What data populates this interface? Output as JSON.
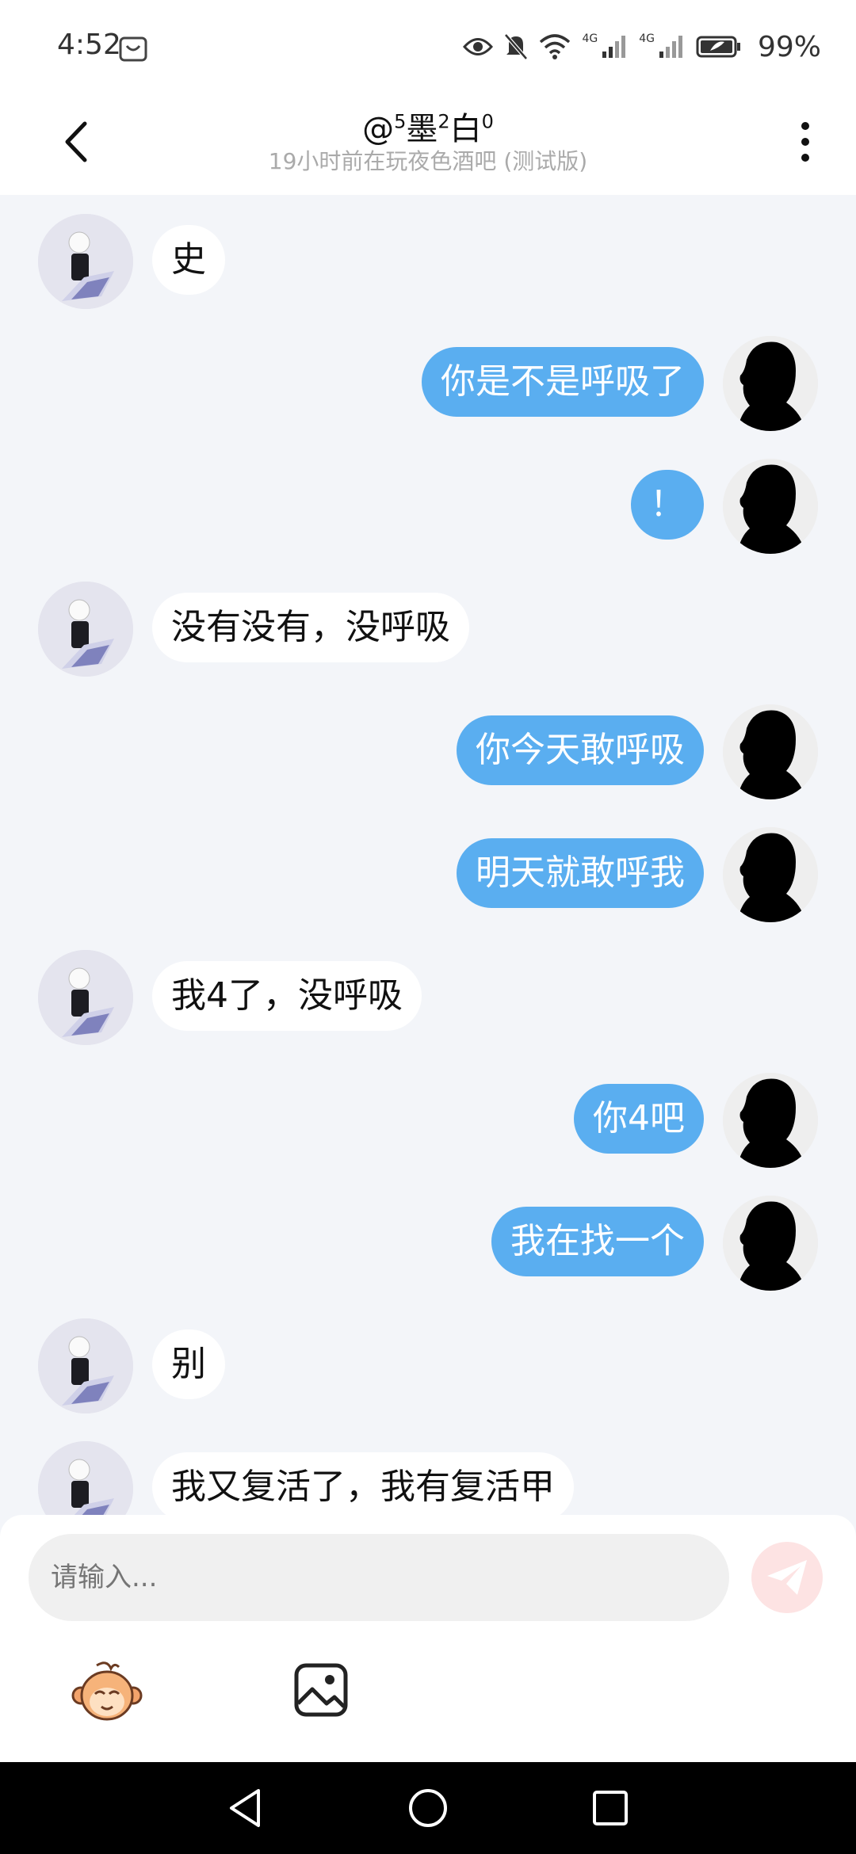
{
  "status_bar": {
    "time": "4:52",
    "network_left": "4G",
    "network_right": "4G",
    "battery": "99%"
  },
  "header": {
    "title_prefix": "@",
    "title_sup1": "5",
    "title_part1": "墨",
    "title_sup2": "2",
    "title_part2": "白",
    "title_sup3": "0",
    "subtitle": "19小时前在玩夜色酒吧 (测试版)"
  },
  "messages": [
    {
      "side": "left",
      "text": "史"
    },
    {
      "side": "right",
      "text": "你是不是呼吸了"
    },
    {
      "side": "right",
      "text": "！"
    },
    {
      "side": "left",
      "text": "没有没有，没呼吸"
    },
    {
      "side": "right",
      "text": "你今天敢呼吸"
    },
    {
      "side": "right",
      "text": "明天就敢呼我"
    },
    {
      "side": "left",
      "text": "我4了，没呼吸"
    },
    {
      "side": "right",
      "text": "你4吧"
    },
    {
      "side": "right",
      "text": "我在找一个"
    },
    {
      "side": "left",
      "text": "别"
    },
    {
      "side": "left",
      "text": "我又复活了，我有复活甲"
    }
  ],
  "input": {
    "placeholder": "请输入..."
  },
  "colors": {
    "accent_bubble": "#5aaef0",
    "background": "#f3f5f9",
    "send_button": "#fde3e3"
  },
  "icons": {
    "back": "chevron-left-icon",
    "more": "more-vertical-icon",
    "send": "send-icon",
    "emoji": "monkey-emoji-icon",
    "image": "image-icon"
  }
}
